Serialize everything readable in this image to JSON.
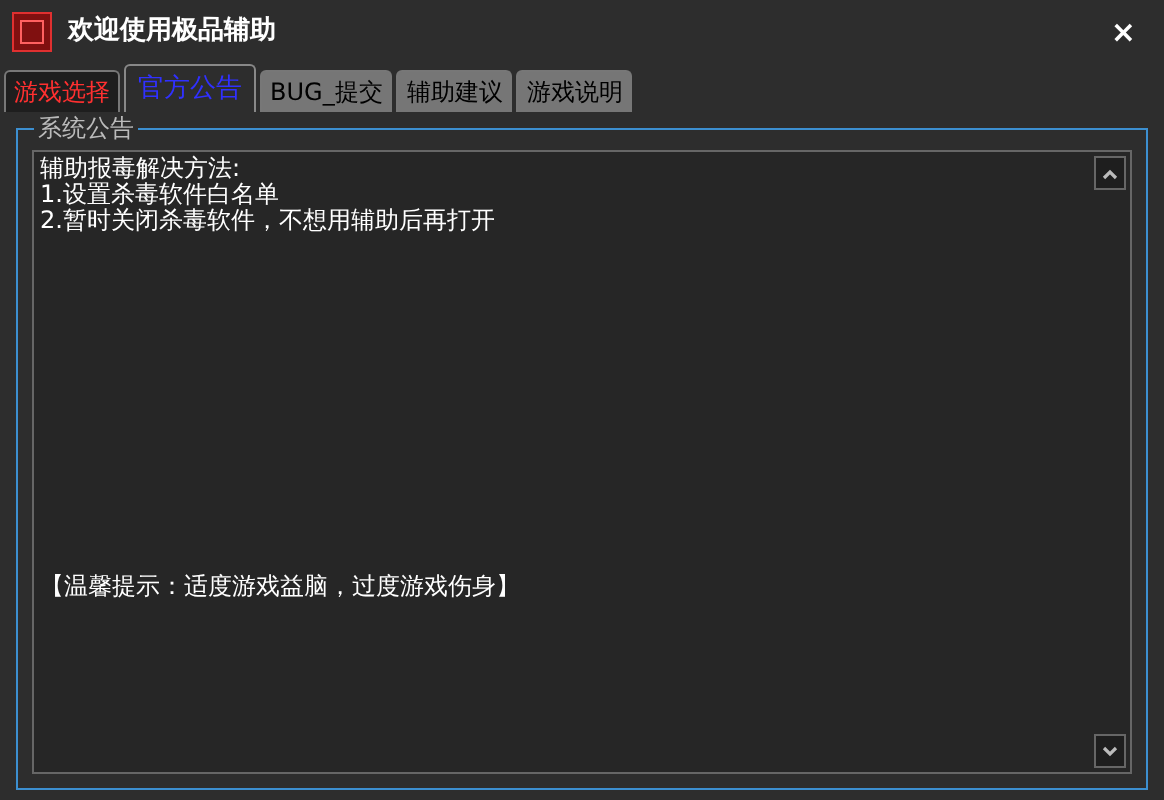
{
  "window": {
    "title": "欢迎使用极品辅助",
    "close": "×"
  },
  "tabs": [
    {
      "label": "游戏选择",
      "selected": false
    },
    {
      "label": "官方公告",
      "selected": true
    },
    {
      "label": "BUG_提交",
      "selected": false
    },
    {
      "label": "辅助建议",
      "selected": false
    },
    {
      "label": "游戏说明",
      "selected": false
    }
  ],
  "group": {
    "title": "系统公告",
    "lines": [
      "辅助报毒解决方法:",
      "1.设置杀毒软件白名单",
      "2.暂时关闭杀毒软件，不想用辅助后再打开"
    ],
    "tip": "【温馨提示：适度游戏益脑，过度游戏伤身】"
  }
}
